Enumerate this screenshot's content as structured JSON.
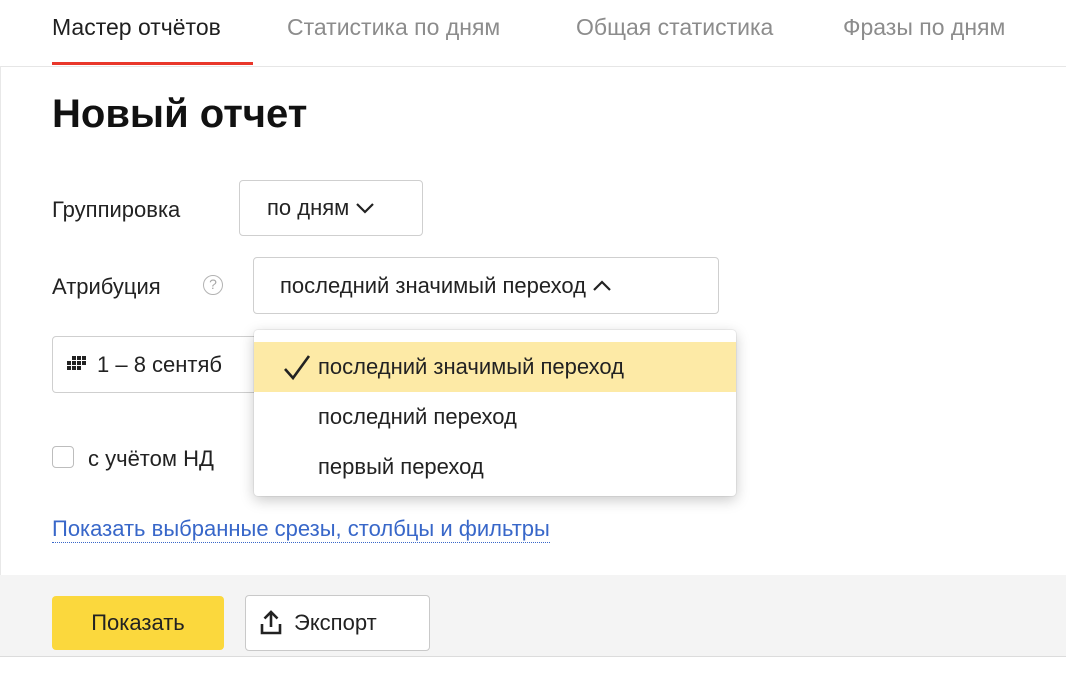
{
  "tabs": [
    {
      "label": "Мастер отчётов",
      "active": true
    },
    {
      "label": "Статистика по дням",
      "active": false
    },
    {
      "label": "Общая статистика",
      "active": false
    },
    {
      "label": "Фразы по дням",
      "active": false
    }
  ],
  "page_title": "Новый отчет",
  "grouping": {
    "label": "Группировка",
    "value": "по дням",
    "icon": "chevron-down-icon"
  },
  "attribution": {
    "label": "Атрибуция",
    "help_icon": "question-circle-icon",
    "value": "последний значимый переход",
    "icon": "chevron-up-icon",
    "expanded": true
  },
  "date_range": {
    "icon": "calendar-icon",
    "value": "1 – 8 сентяб"
  },
  "vat": {
    "label": "с учётом НД",
    "checked": false
  },
  "show_link": "Показать выбранные срезы, столбцы и фильтры",
  "buttons": {
    "show": "Показать",
    "export": "Экспорт",
    "export_icon": "upload-icon"
  },
  "dropdown": {
    "options": [
      {
        "label": "последний значимый переход",
        "selected": true
      },
      {
        "label": "последний переход",
        "selected": false
      },
      {
        "label": "первый переход",
        "selected": false
      }
    ]
  },
  "colors": {
    "accent_red": "#e9372b",
    "primary_yellow": "#fbd83d",
    "selected_option": "#fdeaa6",
    "link_blue": "#3867c9"
  }
}
